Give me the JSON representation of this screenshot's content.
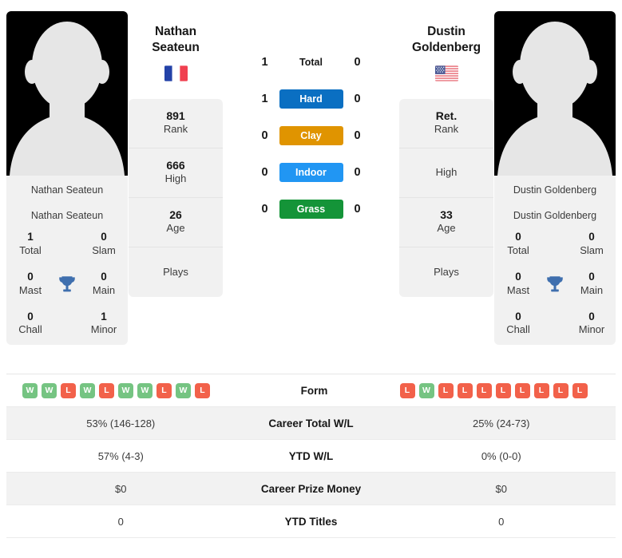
{
  "players": {
    "left": {
      "first_name": "Nathan",
      "last_name": "Seateun",
      "full_name": "Nathan Seateun",
      "country_flag": "fr-flag-icon",
      "rank": "891",
      "rank_label": "Rank",
      "high": "666",
      "high_label": "High",
      "age": "26",
      "age_label": "Age",
      "plays": "",
      "plays_label": "Plays",
      "titles": {
        "owner": "Nathan Seateun",
        "total": "1",
        "total_label": "Total",
        "slam": "0",
        "slam_label": "Slam",
        "mast": "0",
        "mast_label": "Mast",
        "main": "0",
        "main_label": "Main",
        "chall": "0",
        "chall_label": "Chall",
        "minor": "1",
        "minor_label": "Minor"
      },
      "form": [
        "W",
        "W",
        "L",
        "W",
        "L",
        "W",
        "W",
        "L",
        "W",
        "L"
      ],
      "career_total_wl": "53% (146-128)",
      "ytd_wl": "57% (4-3)",
      "career_prize_money": "$0",
      "ytd_titles": "0"
    },
    "right": {
      "first_name": "Dustin",
      "last_name": "Goldenberg",
      "full_name": "Dustin Goldenberg",
      "country_flag": "us-flag-icon",
      "rank": "Ret.",
      "rank_label": "Rank",
      "high": "",
      "high_label": "High",
      "age": "33",
      "age_label": "Age",
      "plays": "",
      "plays_label": "Plays",
      "titles": {
        "owner": "Dustin Goldenberg",
        "total": "0",
        "total_label": "Total",
        "slam": "0",
        "slam_label": "Slam",
        "mast": "0",
        "mast_label": "Mast",
        "main": "0",
        "main_label": "Main",
        "chall": "0",
        "chall_label": "Chall",
        "minor": "0",
        "minor_label": "Minor"
      },
      "form": [
        "L",
        "W",
        "L",
        "L",
        "L",
        "L",
        "L",
        "L",
        "L",
        "L"
      ],
      "career_total_wl": "25% (24-73)",
      "ytd_wl": "0% (0-0)",
      "career_prize_money": "$0",
      "ytd_titles": "0"
    }
  },
  "head_to_head": [
    {
      "label": "Total",
      "left": "1",
      "right": "0",
      "chip": false,
      "color": ""
    },
    {
      "label": "Hard",
      "left": "1",
      "right": "0",
      "chip": true,
      "color": "#0a6fc2"
    },
    {
      "label": "Clay",
      "left": "0",
      "right": "0",
      "chip": true,
      "color": "#e09400"
    },
    {
      "label": "Indoor",
      "left": "0",
      "right": "0",
      "chip": true,
      "color": "#2196f3"
    },
    {
      "label": "Grass",
      "left": "0",
      "right": "0",
      "chip": true,
      "color": "#149438"
    }
  ],
  "comparison_rows": [
    {
      "label": "Form",
      "left": "",
      "right": "",
      "is_form": true,
      "shaded": false
    },
    {
      "label": "Career Total W/L",
      "left": "53% (146-128)",
      "right": "25% (24-73)",
      "is_form": false,
      "shaded": true
    },
    {
      "label": "YTD W/L",
      "left": "57% (4-3)",
      "right": "0% (0-0)",
      "is_form": false,
      "shaded": false
    },
    {
      "label": "Career Prize Money",
      "left": "$0",
      "right": "$0",
      "is_form": false,
      "shaded": true
    },
    {
      "label": "YTD Titles",
      "left": "0",
      "right": "0",
      "is_form": false,
      "shaded": false
    }
  ],
  "colors": {
    "hard": "#0a6fc2",
    "clay": "#e09400",
    "indoor": "#2196f3",
    "grass": "#149438",
    "win": "#75c482",
    "loss": "#f2614a",
    "trophy": "#3f6fae"
  }
}
